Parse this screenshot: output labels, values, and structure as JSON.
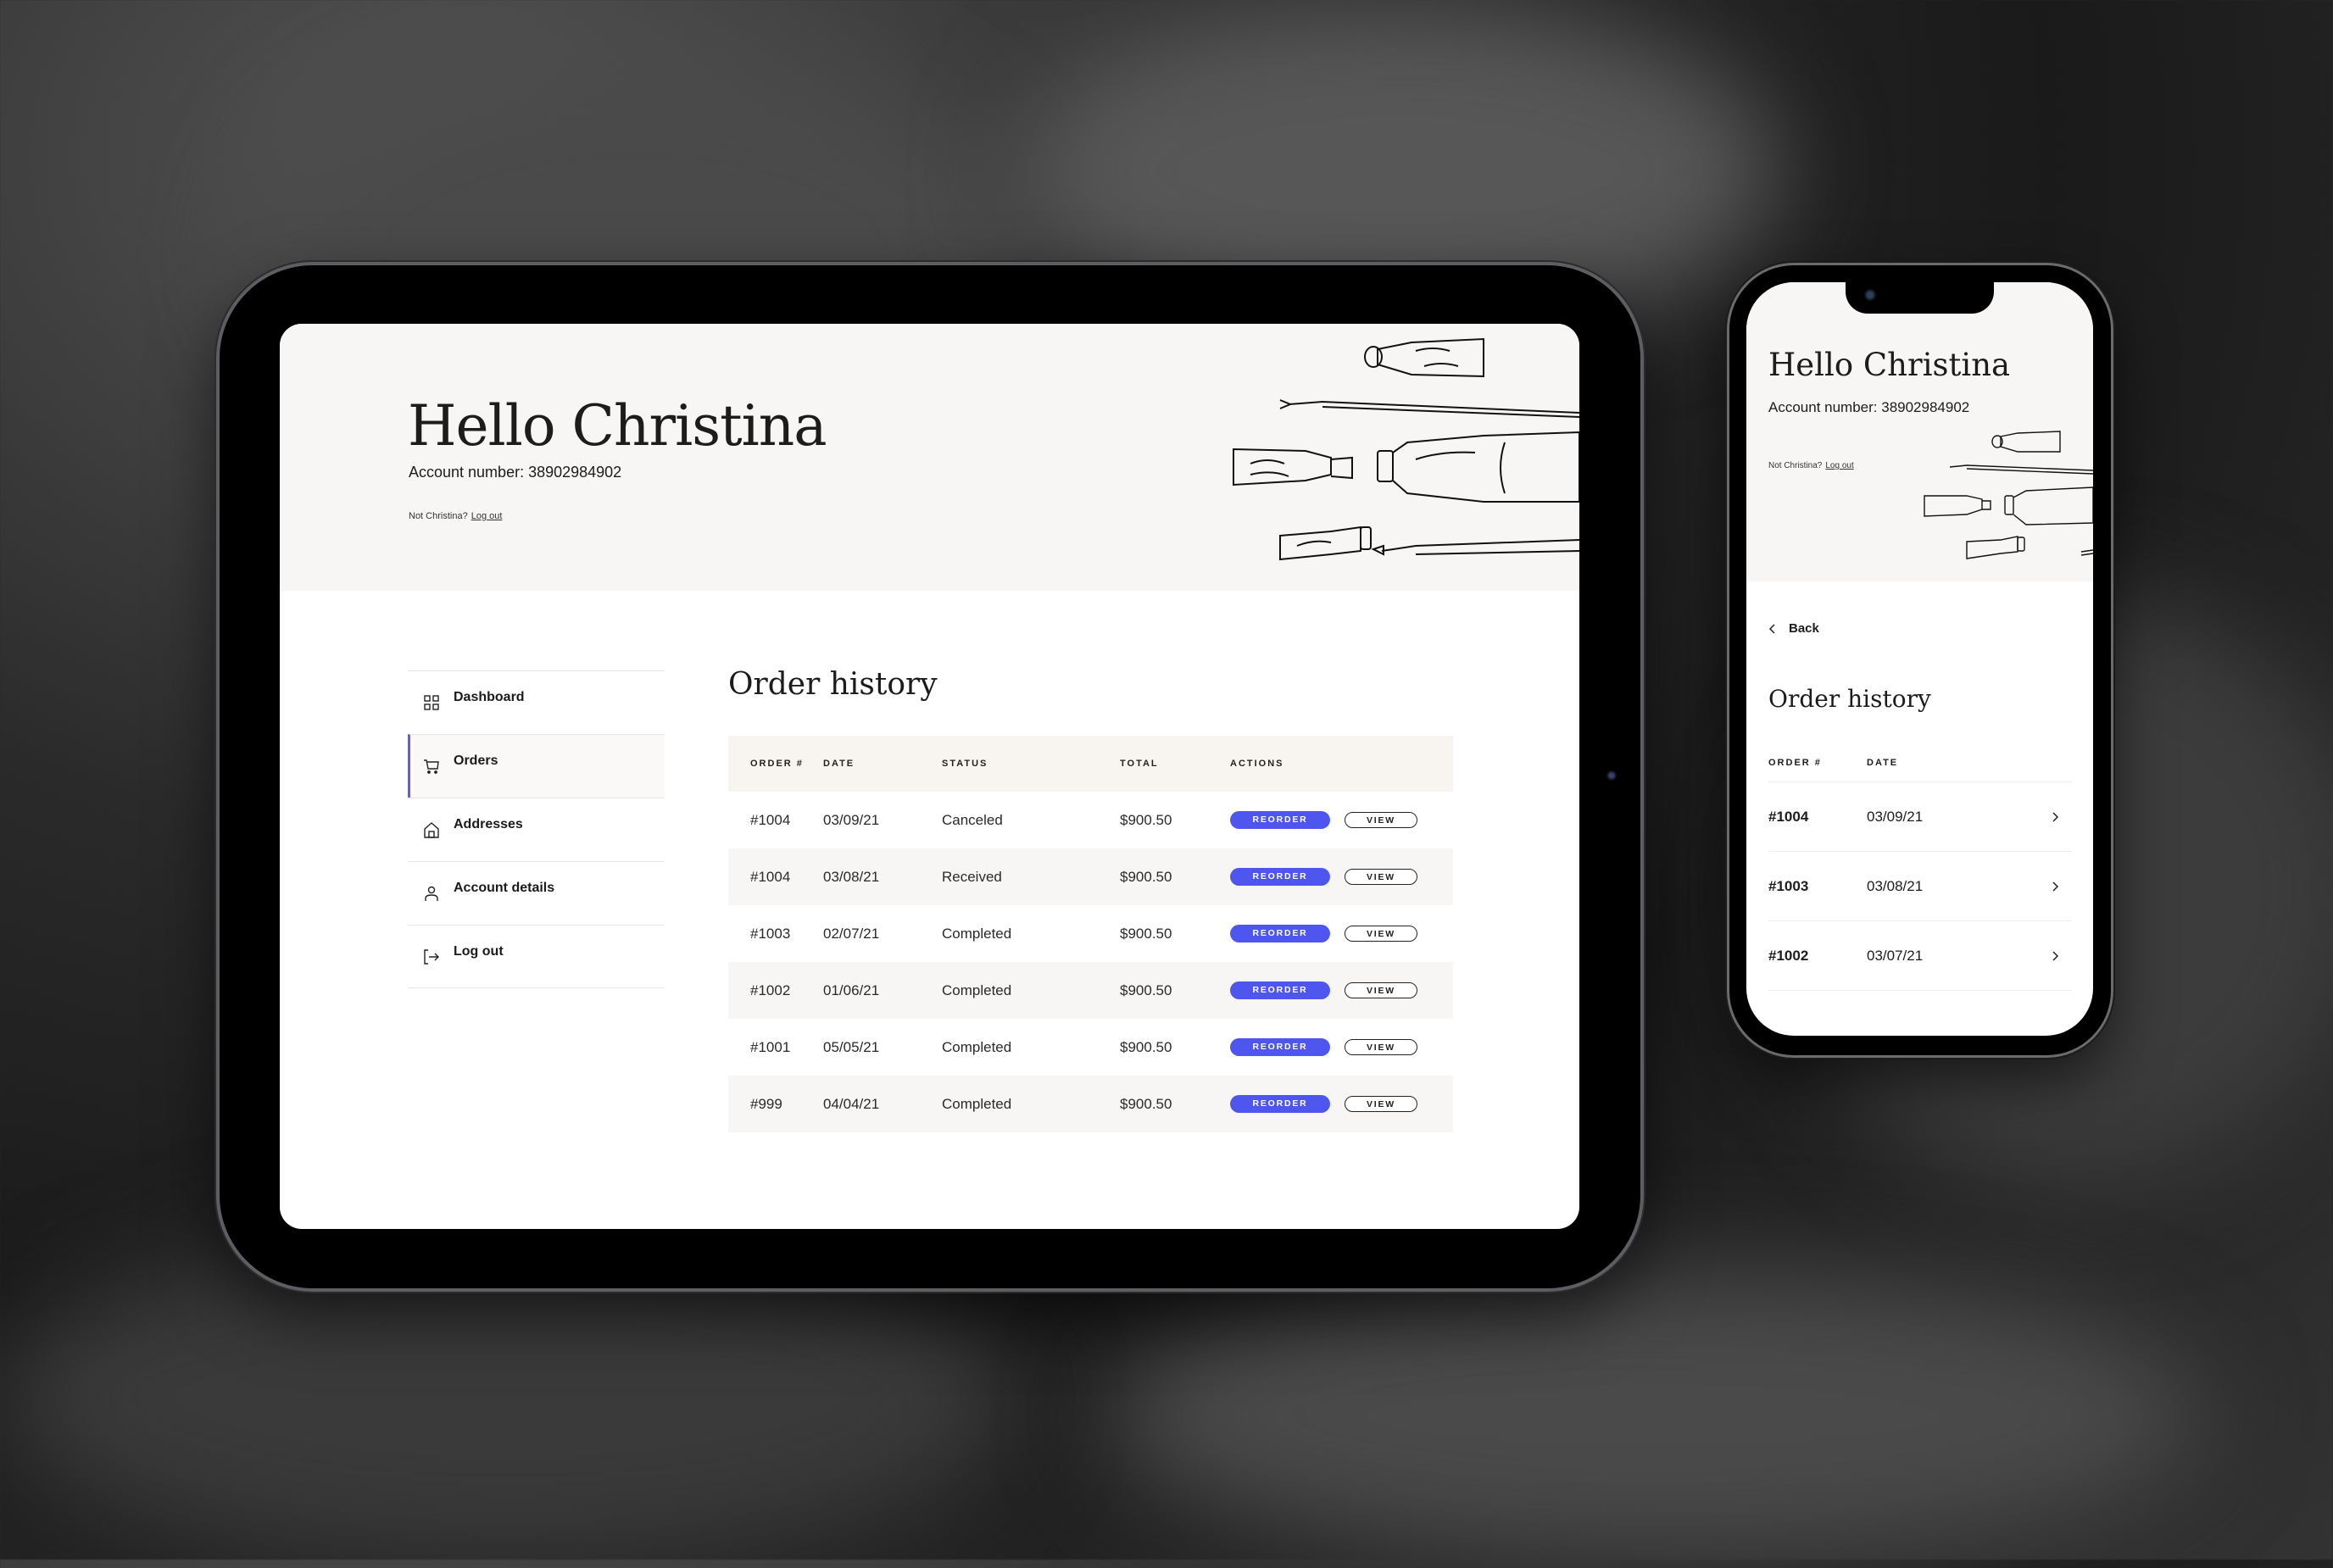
{
  "tablet": {
    "header": {
      "greeting": "Hello Christina",
      "account_number": "Account number: 38902984902",
      "not_user": "Not Christina?",
      "logout_link": "Log out"
    },
    "sidebar": {
      "items": [
        {
          "label": "Dashboard",
          "icon": "grid-icon",
          "active": false
        },
        {
          "label": "Orders",
          "icon": "cart-icon",
          "active": true
        },
        {
          "label": "Addresses",
          "icon": "home-icon",
          "active": false
        },
        {
          "label": "Account details",
          "icon": "user-icon",
          "active": false
        },
        {
          "label": "Log out",
          "icon": "logout-icon",
          "active": false
        }
      ]
    },
    "orders": {
      "title": "Order history",
      "columns": [
        "ORDER #",
        "DATE",
        "STATUS",
        "TOTAL",
        "ACTIONS"
      ],
      "rows": [
        {
          "order": "#1004",
          "date": "03/09/21",
          "status": "Canceled",
          "total": "$900.50"
        },
        {
          "order": "#1004",
          "date": "03/08/21",
          "status": "Received",
          "total": "$900.50"
        },
        {
          "order": "#1003",
          "date": "02/07/21",
          "status": "Completed",
          "total": "$900.50"
        },
        {
          "order": "#1002",
          "date": "01/06/21",
          "status": "Completed",
          "total": "$900.50"
        },
        {
          "order": "#1001",
          "date": "05/05/21",
          "status": "Completed",
          "total": "$900.50"
        },
        {
          "order": "#999",
          "date": "04/04/21",
          "status": "Completed",
          "total": "$900.50"
        }
      ],
      "reorder_label": "REORDER",
      "view_label": "VIEW"
    }
  },
  "phone": {
    "header": {
      "greeting": "Hello Christina",
      "account_number": "Account number: 38902984902",
      "not_user": "Not Christina?",
      "logout_link": "Log out"
    },
    "back_label": "Back",
    "orders": {
      "title": "Order history",
      "columns": [
        "ORDER #",
        "DATE"
      ],
      "rows": [
        {
          "order": "#1004",
          "date": "03/09/21"
        },
        {
          "order": "#1003",
          "date": "03/08/21"
        },
        {
          "order": "#1002",
          "date": "03/07/21"
        }
      ]
    }
  },
  "colors": {
    "accent": "#4f56f0",
    "header_bg": "#f7f6f4",
    "table_header_bg": "#f8f4ef",
    "row_alt_bg": "#f7f6f4"
  }
}
